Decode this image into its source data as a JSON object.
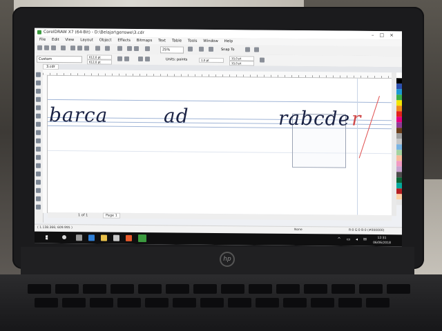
{
  "window": {
    "title": "CorelDRAW X7 (64-Bit) - D:\\Belajar\\genswe\\3.cdr",
    "app_icon": "coreldraw-icon"
  },
  "menu": [
    "File",
    "Edit",
    "View",
    "Layout",
    "Object",
    "Effects",
    "Bitmaps",
    "Text",
    "Table",
    "Tools",
    "Window",
    "Help"
  ],
  "toolbar": {
    "zoom": "25%",
    "snap_label": "Snap To"
  },
  "property_bar": {
    "preset": "Custom",
    "width": "612,0 pt",
    "height": "612,0 pt",
    "units": "Units: points",
    "nudge": "1,0 pt",
    "dup_x": "15,0 pt",
    "dup_y": "15,0 pt"
  },
  "document_tab": "3.cdr",
  "canvas": {
    "words": [
      "barca",
      "ad",
      "rabcde",
      "r"
    ],
    "highlight_color": "#d04a4a",
    "ink_color": "#1b2345"
  },
  "page_bar": {
    "counter": "1 of 1",
    "tab_label": "Page 1"
  },
  "status": {
    "coords": "( 1.138.366; 609.995 )",
    "fill": "None",
    "stroke": "R:0 G:0 B:0 (#000000)"
  },
  "taskbar": {
    "time": "12:31",
    "date": "06/06/2018"
  },
  "device": {
    "logo": "hp"
  }
}
